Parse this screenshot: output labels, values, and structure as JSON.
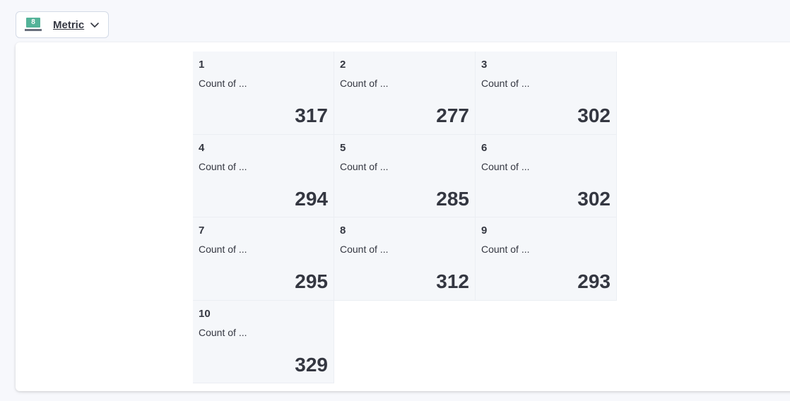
{
  "switcher": {
    "label": "Metric",
    "icon": "metric-vis-icon",
    "icon_glyph": "8",
    "chevron_icon": "chevron-down-icon"
  },
  "metrics": [
    {
      "title": "1",
      "subtitle": "Count of ...",
      "value": "317"
    },
    {
      "title": "2",
      "subtitle": "Count of ...",
      "value": "277"
    },
    {
      "title": "3",
      "subtitle": "Count of ...",
      "value": "302"
    },
    {
      "title": "4",
      "subtitle": "Count of ...",
      "value": "294"
    },
    {
      "title": "5",
      "subtitle": "Count of ...",
      "value": "285"
    },
    {
      "title": "6",
      "subtitle": "Count of ...",
      "value": "302"
    },
    {
      "title": "7",
      "subtitle": "Count of ...",
      "value": "295"
    },
    {
      "title": "8",
      "subtitle": "Count of ...",
      "value": "312"
    },
    {
      "title": "9",
      "subtitle": "Count of ...",
      "value": "293"
    },
    {
      "title": "10",
      "subtitle": "Count of ...",
      "value": "329"
    }
  ],
  "colors": {
    "tile_background": "#f5f7fa",
    "text": "#343741",
    "icon_accent": "#54b399"
  }
}
